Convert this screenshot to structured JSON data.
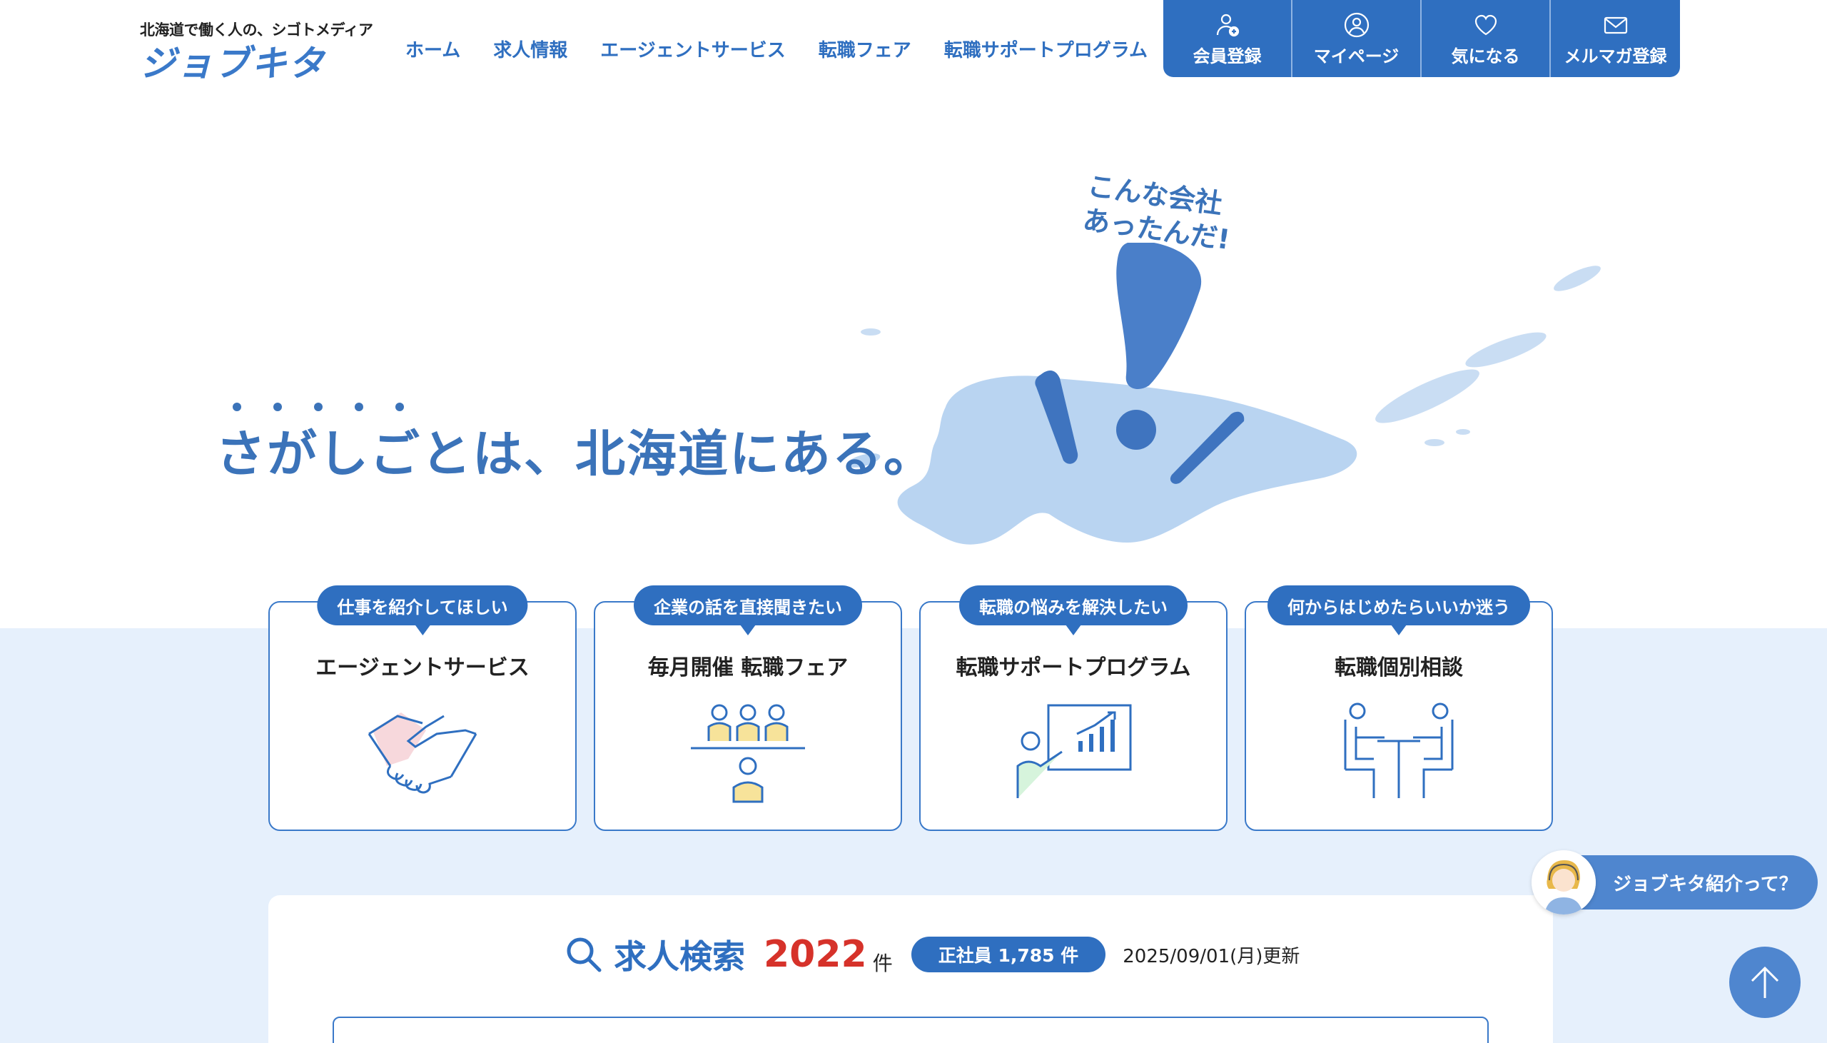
{
  "header": {
    "tagline": "北海道で働く人の、シゴトメディア",
    "logo_text": "ジョブキタ",
    "nav": [
      "ホーム",
      "求人情報",
      "エージェントサービス",
      "転職フェア",
      "転職サポートプログラム"
    ],
    "util": [
      {
        "label": "会員登録",
        "icon": "user-plus-icon"
      },
      {
        "label": "マイページ",
        "icon": "user-circle-icon"
      },
      {
        "label": "気になる",
        "icon": "heart-icon"
      },
      {
        "label": "メルマガ登録",
        "icon": "mail-icon"
      }
    ]
  },
  "hero": {
    "catch": "さがしごとは、北海道にある。",
    "handwritten_line1": "こんな会社",
    "handwritten_line2": "あったんだ!"
  },
  "services": [
    {
      "badge": "仕事を紹介してほしい",
      "title": "エージェントサービス",
      "icon": "handshake-icon"
    },
    {
      "badge": "企業の話を直接聞きたい",
      "title": "毎月開催 転職フェア",
      "icon": "seminar-icon"
    },
    {
      "badge": "転職の悩みを解決したい",
      "title": "転職サポートプログラム",
      "icon": "presentation-icon"
    },
    {
      "badge": "何からはじめたらいいか迷う",
      "title": "転職個別相談",
      "icon": "consultation-icon"
    }
  ],
  "search": {
    "title": "求人検索",
    "count": "2022",
    "count_unit": "件",
    "regular_badge": "正社員 1,785 件",
    "updated": "2025/09/01(月)更新"
  },
  "floating": {
    "intro_label": "ジョブキタ紹介って？"
  },
  "colors": {
    "primary": "#2f6fc0",
    "band": "#e6f0fc",
    "count_red": "#d6322a"
  }
}
